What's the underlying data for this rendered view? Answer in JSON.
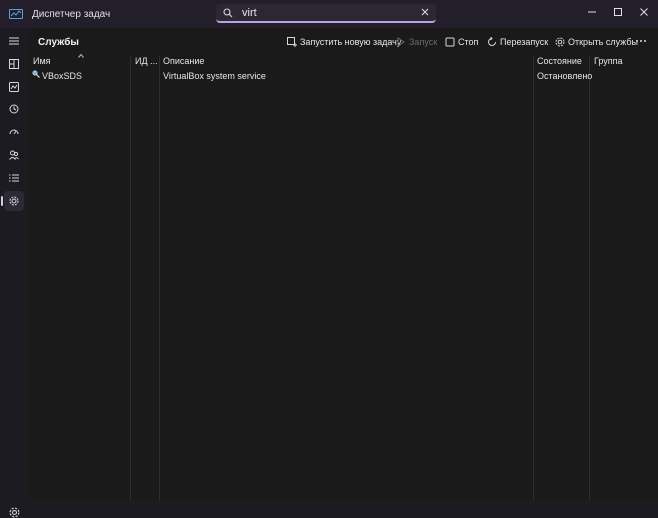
{
  "window": {
    "title": "Диспетчер задач"
  },
  "search": {
    "value": "virt"
  },
  "toolbar": {
    "page_title": "Службы",
    "new_task_label": "Запустить новую задачу",
    "start_label": "Запуск",
    "stop_label": "Стоп",
    "restart_label": "Перезапуск",
    "open_services_label": "Открыть службы"
  },
  "table": {
    "columns": [
      "Имя",
      "ИД ...",
      "Описание",
      "Состояние",
      "Группа"
    ],
    "rows": [
      {
        "name": "VBoxSDS",
        "pid": "",
        "description": "VirtualBox system service",
        "status": "Остановлено",
        "group": ""
      }
    ]
  },
  "colors": {
    "accent": "#b8a2e6",
    "background": "#1a1a1a"
  }
}
